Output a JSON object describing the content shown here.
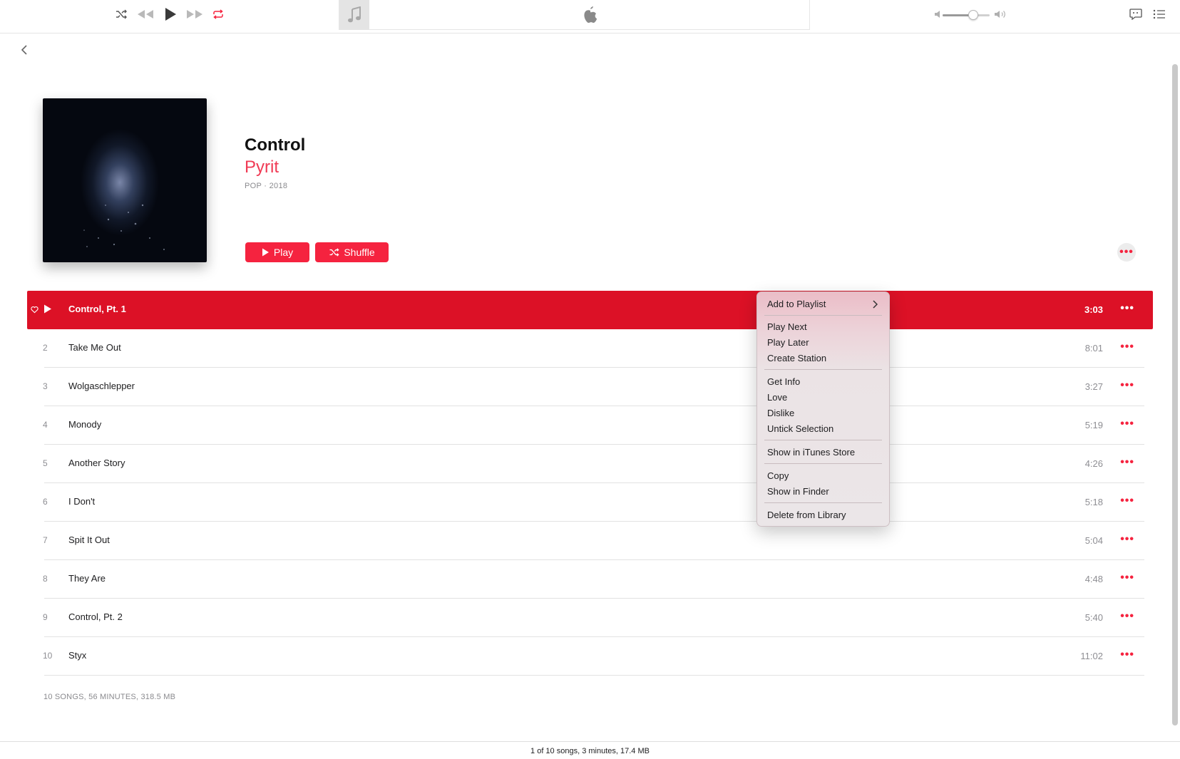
{
  "toolbar": {
    "icons": [
      "shuffle-icon",
      "previous-icon",
      "play-icon",
      "next-icon",
      "repeat-icon",
      "music-note-icon",
      "apple-logo-icon",
      "volume-low-icon",
      "volume-high-icon",
      "lyrics-icon",
      "up-next-icon"
    ],
    "volume_level": 0.65,
    "accent": "#f5233f"
  },
  "album": {
    "title": "Control",
    "artist": "Pyrit",
    "meta": "POP · 2018",
    "play_label": "Play",
    "shuffle_label": "Shuffle"
  },
  "tracks": [
    {
      "num": "1",
      "name": "Control, Pt. 1",
      "duration": "3:03",
      "selected": true
    },
    {
      "num": "2",
      "name": "Take Me Out",
      "duration": "8:01"
    },
    {
      "num": "3",
      "name": "Wolgaschlepper",
      "duration": "3:27"
    },
    {
      "num": "4",
      "name": "Monody",
      "duration": "5:19"
    },
    {
      "num": "5",
      "name": "Another Story",
      "duration": "4:26"
    },
    {
      "num": "6",
      "name": "I Don't",
      "duration": "5:18"
    },
    {
      "num": "7",
      "name": "Spit It Out",
      "duration": "5:04"
    },
    {
      "num": "8",
      "name": "They Are",
      "duration": "4:48"
    },
    {
      "num": "9",
      "name": "Control, Pt. 2",
      "duration": "5:40"
    },
    {
      "num": "10",
      "name": "Styx",
      "duration": "11:02"
    }
  ],
  "summary": "10 SONGS, 56 MINUTES, 318.5 MB",
  "status": "1 of 10 songs, 3 minutes, 17.4 MB",
  "context_menu": {
    "add_to_playlist": "Add to Playlist",
    "play_next": "Play Next",
    "play_later": "Play Later",
    "create_station": "Create Station",
    "get_info": "Get Info",
    "love": "Love",
    "dislike": "Dislike",
    "untick_selection": "Untick Selection",
    "show_in_itunes_store": "Show in iTunes Store",
    "copy": "Copy",
    "show_in_finder": "Show in Finder",
    "delete_from_library": "Delete from Library"
  }
}
